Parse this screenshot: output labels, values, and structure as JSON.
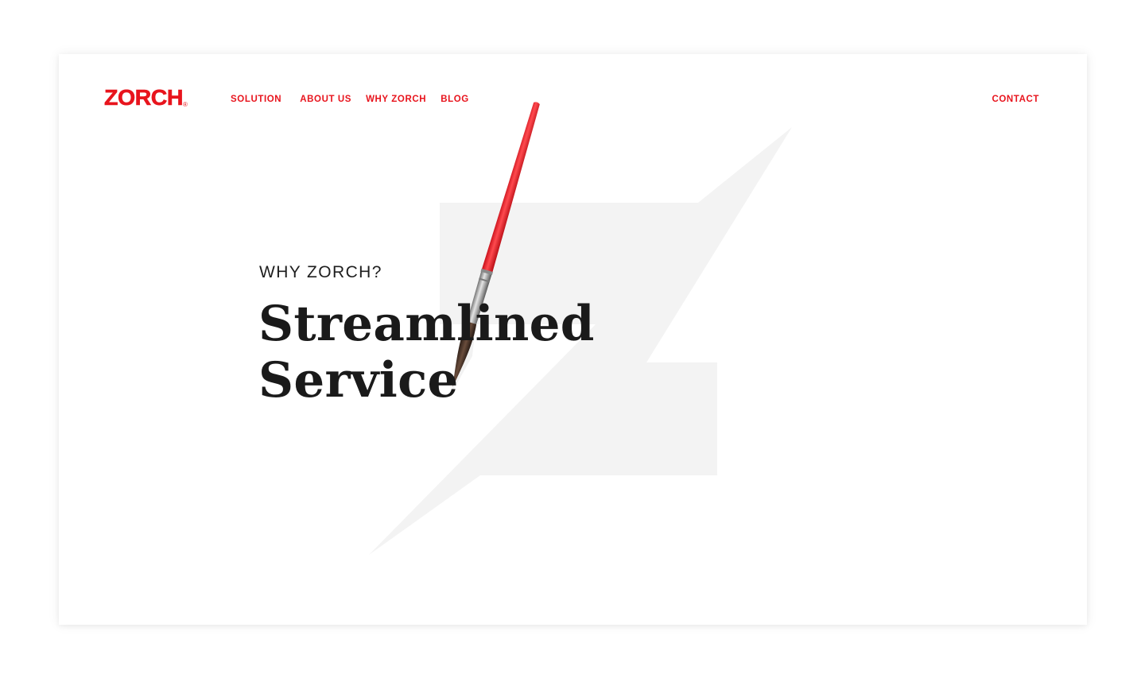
{
  "brand": {
    "name": "ZORCH",
    "registered_mark": "®"
  },
  "nav": {
    "items": [
      {
        "label": "SOLUTION"
      },
      {
        "label": "ABOUT US"
      },
      {
        "label": "WHY ZORCH"
      },
      {
        "label": "BLOG"
      }
    ],
    "contact_label": "CONTACT"
  },
  "hero": {
    "eyebrow": "WHY ZORCH?",
    "headline_line1": "Streamlined",
    "headline_line2": "Service"
  },
  "colors": {
    "accent": "#e8141d",
    "text": "#1a1a1a",
    "background": "#ffffff",
    "watermark": "#f3f3f3"
  },
  "icons": {
    "background_mark": "zorch-lightning-z-mark",
    "hero_illustration": "paint-brush"
  }
}
